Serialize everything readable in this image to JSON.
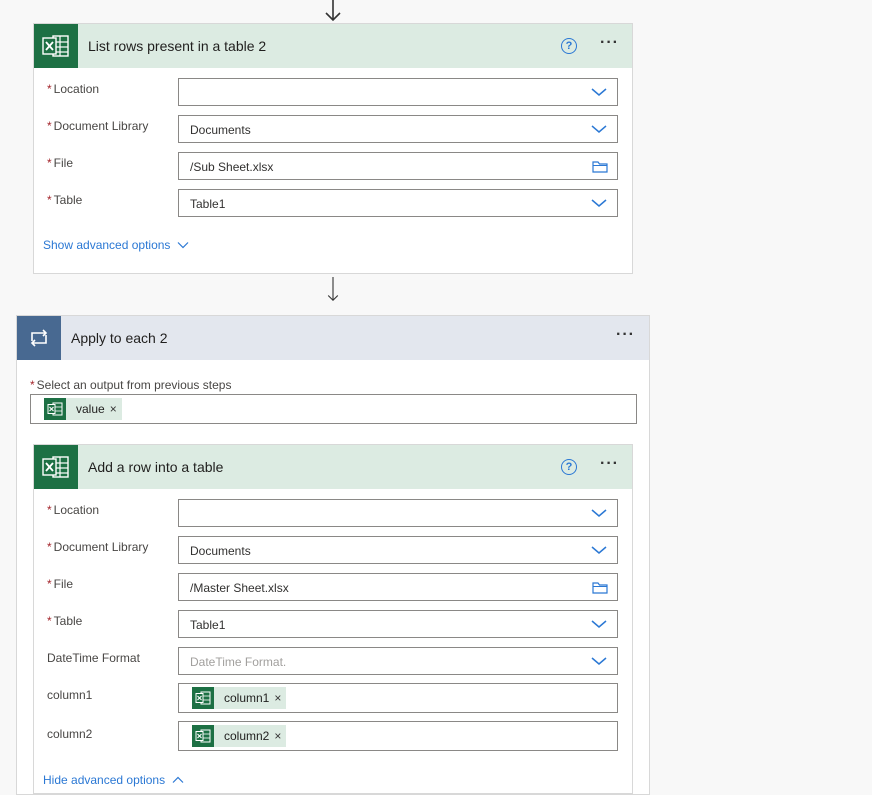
{
  "colors": {
    "excel_green": "#1d7044",
    "loop_blue": "#486991",
    "link_blue": "#2b78d4",
    "required_red": "#a4262c"
  },
  "list_rows_card": {
    "title": "List rows present in a table 2",
    "icon": "excel-icon",
    "fields": [
      {
        "label": "Location",
        "required": "*",
        "value": "",
        "control": "dropdown"
      },
      {
        "label": "Document Library",
        "required": "*",
        "value": "Documents",
        "control": "dropdown"
      },
      {
        "label": "File",
        "required": "*",
        "value": "/Sub Sheet.xlsx",
        "control": "file-picker"
      },
      {
        "label": "Table",
        "required": "*",
        "value": "Table1",
        "control": "dropdown"
      }
    ],
    "advanced_link": "Show advanced options"
  },
  "apply_each_card": {
    "title": "Apply to each 2",
    "icon": "loop-icon",
    "output_label": "Select an output from previous steps",
    "required": "*",
    "output_token": "value"
  },
  "add_row_card": {
    "title": "Add a row into a table",
    "icon": "excel-icon",
    "fields": [
      {
        "label": "Location",
        "required": "*",
        "value": ""
      },
      {
        "label": "Document Library",
        "required": "*",
        "value": "Documents"
      },
      {
        "label": "File",
        "required": "*",
        "value": "/Master Sheet.xlsx"
      },
      {
        "label": "Table",
        "required": "*",
        "value": "Table1"
      },
      {
        "label": "DateTime Format",
        "required": "",
        "placeholder": "DateTime Format."
      },
      {
        "label": "column1",
        "required": "",
        "token": "column1"
      },
      {
        "label": "column2",
        "required": "",
        "token": "column2"
      }
    ],
    "advanced_link": "Hide advanced options"
  },
  "help_glyph": "?",
  "more_glyph": "···",
  "remove_glyph": "×"
}
